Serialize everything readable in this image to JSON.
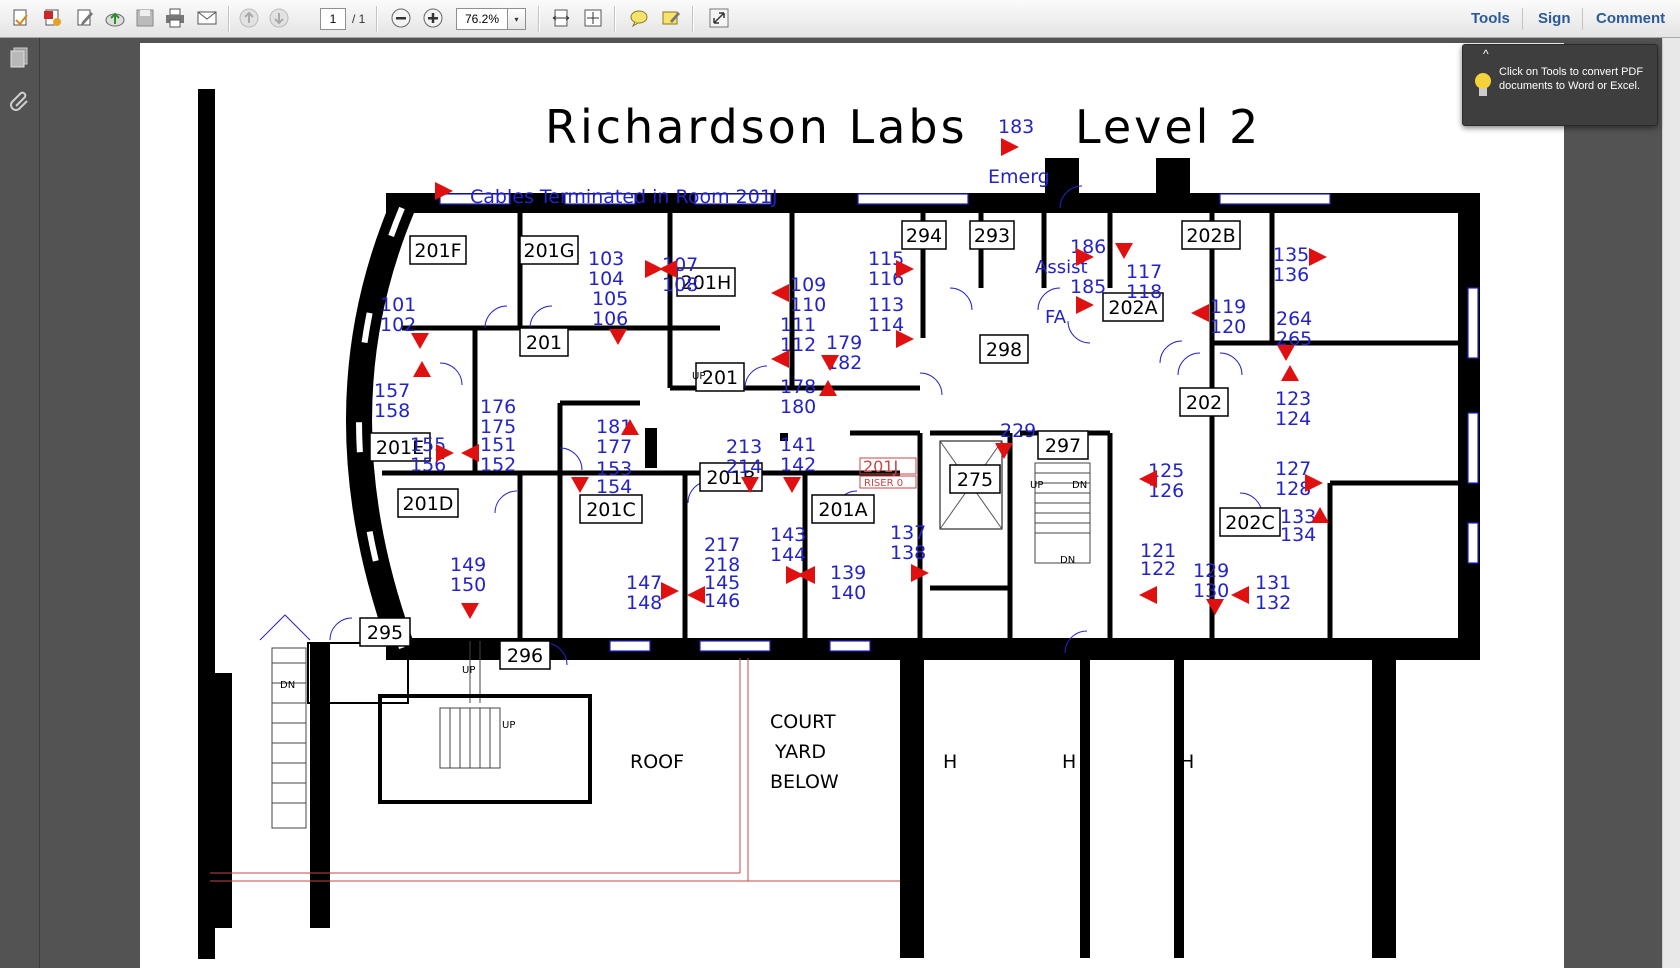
{
  "toolbar": {
    "page_number": "1",
    "page_total": "/ 1",
    "zoom": "76.2%",
    "zoom_dropdown": "▾",
    "right_links": [
      "Tools",
      "Sign",
      "Comment"
    ]
  },
  "tooltip": {
    "text": "Click on Tools to convert PDF documents to Word or Excel.",
    "collapse": "^"
  },
  "plan": {
    "title_left": "Richardson  Labs",
    "title_right": "Level  2",
    "emerg_num": "183",
    "emerg_label": "Emerg",
    "legend": "Cables  Terminated  in  Room  201J",
    "rooms": [
      {
        "label": "201F"
      },
      {
        "label": "201G"
      },
      {
        "label": "201H"
      },
      {
        "label": "294"
      },
      {
        "label": "293"
      },
      {
        "label": "202B"
      },
      {
        "label": "202A"
      },
      {
        "label": "201"
      },
      {
        "label": "201"
      },
      {
        "label": "298"
      },
      {
        "label": "202"
      },
      {
        "label": "201E"
      },
      {
        "label": "201D"
      },
      {
        "label": "201C"
      },
      {
        "label": "201B"
      },
      {
        "label": "201A"
      },
      {
        "label": "275"
      },
      {
        "label": "297"
      },
      {
        "label": "202C"
      },
      {
        "label": "295"
      },
      {
        "label": "296"
      }
    ],
    "cables": [
      "101",
      "102",
      "103",
      "104",
      "105",
      "106",
      "107",
      "108",
      "109",
      "110",
      "111",
      "112",
      "115",
      "116",
      "113",
      "114",
      "179",
      "182",
      "178",
      "180",
      "186",
      "185",
      "117",
      "118",
      "119",
      "120",
      "135",
      "136",
      "264",
      "265",
      "157",
      "158",
      "176",
      "175",
      "151",
      "152",
      "181",
      "177",
      "153",
      "154",
      "155",
      "156",
      "213",
      "214",
      "141",
      "142",
      "229",
      "123",
      "124",
      "125",
      "126",
      "127",
      "128",
      "133",
      "134",
      "149",
      "150",
      "147",
      "148",
      "217",
      "218",
      "145",
      "146",
      "143",
      "144",
      "139",
      "140",
      "137",
      "138",
      "121",
      "122",
      "129",
      "130",
      "131",
      "132"
    ],
    "assist": "Assist",
    "fa": "FA",
    "riser": "RISER 0",
    "room_201j": "201J",
    "court": [
      "COURT",
      "YARD",
      "BELOW"
    ],
    "roof": "ROOF",
    "h": [
      "H",
      "H",
      "H"
    ],
    "stair_labels": [
      "UP",
      "UP",
      "UP",
      "UP",
      "DN",
      "DN",
      "DN"
    ]
  }
}
